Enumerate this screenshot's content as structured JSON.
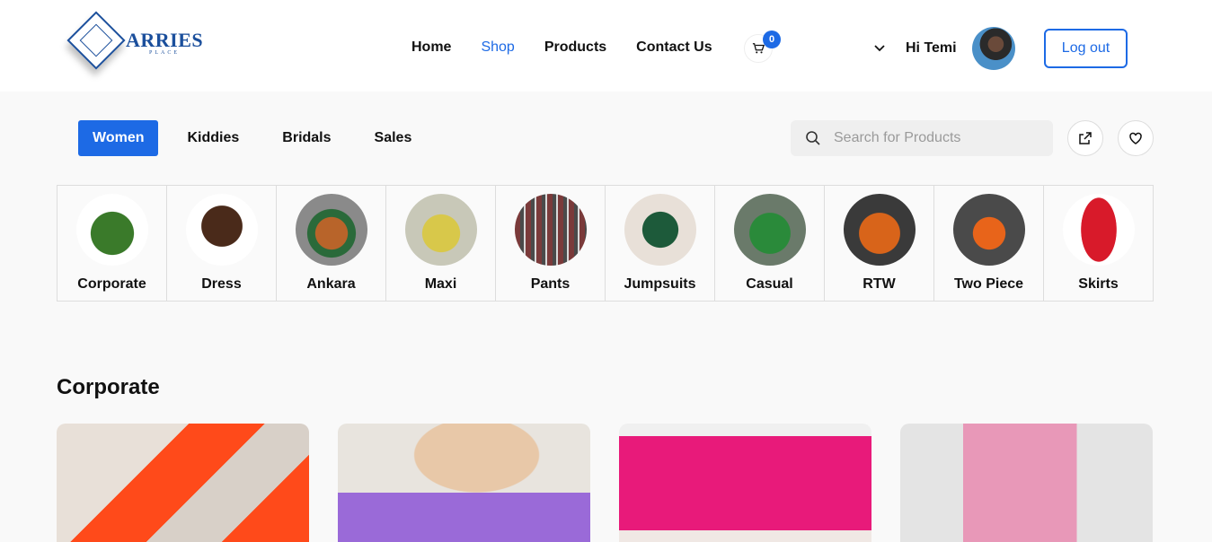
{
  "brand": {
    "name": "ARRIES",
    "sub": "PLACE",
    "color": "#1b4f9c"
  },
  "nav": {
    "items": [
      "Home",
      "Shop",
      "Products",
      "Contact Us"
    ],
    "active": "Shop"
  },
  "cart": {
    "count": "0",
    "icon": "cart-icon"
  },
  "user": {
    "greeting": "Hi Temi",
    "logout_label": "Log out"
  },
  "tabs": [
    "Women",
    "Kiddies",
    "Bridals",
    "Sales"
  ],
  "active_tab": "Women",
  "search": {
    "placeholder": "Search for Products"
  },
  "categories": [
    {
      "label": "Corporate",
      "color": "#3a7a2a"
    },
    {
      "label": "Dress",
      "color": "#4a2a1a"
    },
    {
      "label": "Ankara",
      "color": "#b8642a"
    },
    {
      "label": "Maxi",
      "color": "#d8c84a"
    },
    {
      "label": "Pants",
      "color": "#7a3a3a"
    },
    {
      "label": "Jumpsuits",
      "color": "#1d5a3a"
    },
    {
      "label": "Casual",
      "color": "#2a8a3a"
    },
    {
      "label": "RTW",
      "color": "#d8641a"
    },
    {
      "label": "Two Piece",
      "color": "#e8641a"
    },
    {
      "label": "Skirts",
      "color": "#d81a2a"
    }
  ],
  "section": {
    "title": "Corporate"
  },
  "colors": {
    "accent": "#1d6ae5"
  }
}
